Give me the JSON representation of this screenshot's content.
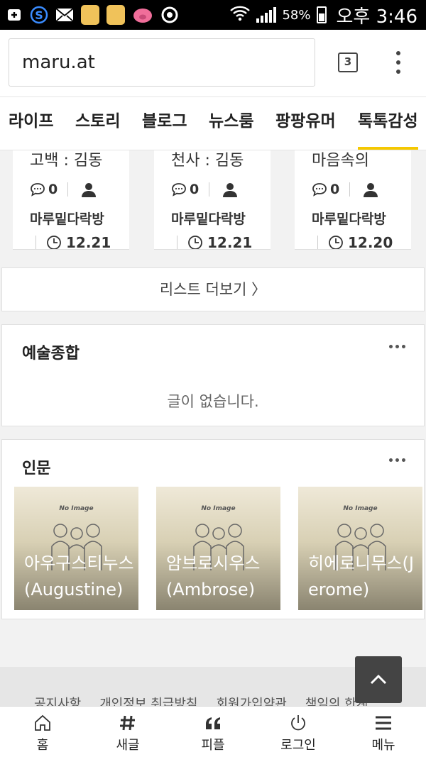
{
  "status_bar": {
    "battery_percent": "58%",
    "time": "오후 3:46",
    "battery_level": 0.58
  },
  "browser": {
    "url": "maru.at",
    "tab_count": "3"
  },
  "categories": [
    "라이프",
    "스토리",
    "블로그",
    "뉴스룸",
    "팡팡유머",
    "톡톡감성"
  ],
  "active_category": "톡톡감성",
  "cards": [
    {
      "title": "고백 : 김동",
      "comments": "0",
      "board": "마루밑다락방",
      "date": "12.21"
    },
    {
      "title": "천사 : 김동",
      "comments": "0",
      "board": "마루밑다락방",
      "date": "12.21"
    },
    {
      "title": "마음속의",
      "comments": "0",
      "board": "마루밑다락방",
      "date": "12.20"
    }
  ],
  "more_list_label": "리스트 더보기 〉",
  "sections": {
    "art": {
      "title": "예술종합",
      "empty_text": "글이 없습니다."
    },
    "humanities": {
      "title": "인문",
      "no_image_label": "No Image",
      "items": [
        {
          "title": "아우구스티누스(Augustine)"
        },
        {
          "title": "암브로시우스(Ambrose)"
        },
        {
          "title": "히에로니무스(Jerome)"
        }
      ]
    }
  },
  "footer_links": [
    "공지사항",
    "개인정보 취급방침",
    "회원가입약관",
    "책임의 한계"
  ],
  "bottom_nav": [
    {
      "label": "홈",
      "icon": "home-icon"
    },
    {
      "label": "새글",
      "icon": "hash-icon"
    },
    {
      "label": "피플",
      "icon": "quote-icon"
    },
    {
      "label": "로그인",
      "icon": "power-icon"
    },
    {
      "label": "메뉴",
      "icon": "menu-icon"
    }
  ],
  "colors": {
    "accent": "#f5c800",
    "top_button": "#444444"
  }
}
